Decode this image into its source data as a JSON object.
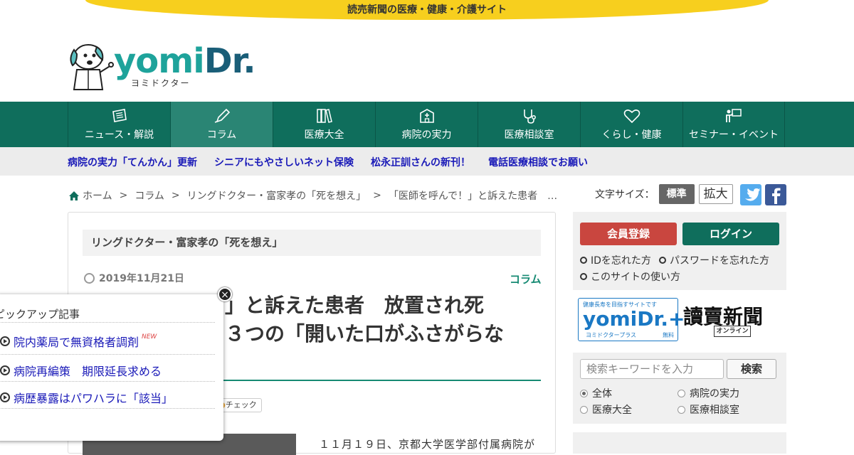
{
  "banner": {
    "text": "読売新聞の医療・健康・介護サイト"
  },
  "logo": {
    "main": "yomi",
    "dr": "Dr.",
    "sub": "ヨミドクター"
  },
  "nav": [
    {
      "label": "ニュース・解説",
      "icon": "news-icon"
    },
    {
      "label": "コラム",
      "icon": "pen-icon",
      "active": true
    },
    {
      "label": "医療大全",
      "icon": "books-icon"
    },
    {
      "label": "病院の実力",
      "icon": "hospital-icon"
    },
    {
      "label": "医療相談室",
      "icon": "stethoscope-icon"
    },
    {
      "label": "くらし・健康",
      "icon": "heart-icon"
    },
    {
      "label": "セミナー・イベント",
      "icon": "seminar-icon"
    }
  ],
  "subnav": [
    "病院の実力「てんかん」更新",
    "シニアにもやさしいネット保険",
    "松永正訓さんの新刊！",
    "電話医療相談でお願い"
  ],
  "breadcrumb": [
    "ホーム",
    ">",
    "コラム",
    ">",
    "リングドクター・富家孝の「死を想え」",
    ">",
    "「医師を呼んで！」と訴えた患者　…"
  ],
  "fontsize": {
    "label": "文字サイズ：",
    "standard": "標準",
    "large": "拡大"
  },
  "social": {
    "twitter": "t",
    "facebook": "f"
  },
  "article": {
    "series": "リングドクター・富家孝の「死を想え」",
    "date": "2019年11月21日",
    "category": "コラム",
    "title_line1": "！」と訴えた患者　放置され死",
    "title_line2": "た３つの「開いた口がふさがらな",
    "check_tag": "チェック",
    "body_start": "１１月１９日、京都大学医学部付属病院が"
  },
  "sidebar": {
    "register": "会員登録",
    "login": "ログイン",
    "forgot_id": "IDを忘れた方",
    "forgot_password": "パスワードを忘れた方",
    "howto": "このサイトの使い方",
    "plus": {
      "small": "健康長寿を目指すサイトです",
      "main": "yomiDr.+",
      "sub": "ヨミドクタープラス",
      "free": "無料"
    },
    "yomiuri": {
      "main": "讀賣新聞",
      "sub": "オンライン"
    }
  },
  "search": {
    "placeholder": "検索キーワードを入力",
    "button": "検索",
    "options": [
      {
        "label": "全体",
        "selected": true
      },
      {
        "label": "病院の実力",
        "selected": false
      },
      {
        "label": "医療大全",
        "selected": false
      },
      {
        "label": "医療相談室",
        "selected": false
      }
    ]
  },
  "popup": {
    "title": "ピックアップ記事",
    "items": [
      "院内薬局で無資格者調剤",
      "病院再編策　期限延長求める",
      "病歴暴露はパワハラに「該当」"
    ],
    "new_badge": "NEW",
    "close": "×"
  },
  "colors": {
    "brand_green": "#0f6e5c",
    "banner_yellow": "#f7cf1e",
    "link_blue": "#1a1ab8",
    "register_red": "#c9463f"
  }
}
